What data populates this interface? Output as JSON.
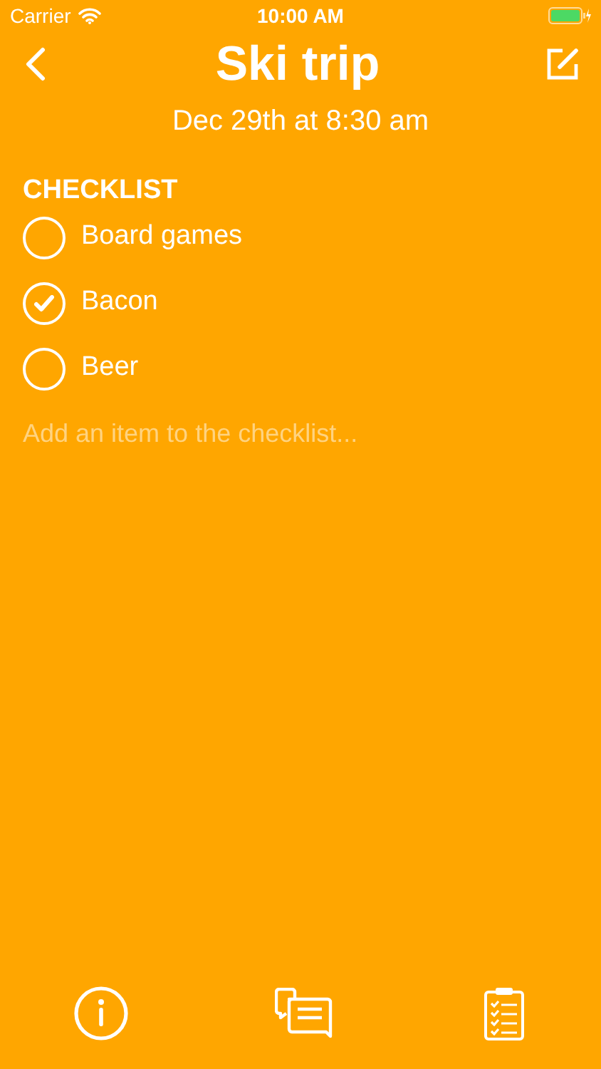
{
  "status_bar": {
    "carrier": "Carrier",
    "time": "10:00 AM"
  },
  "header": {
    "title": "Ski trip",
    "subtitle": "Dec 29th at 8:30 am"
  },
  "checklist": {
    "heading": "CHECKLIST",
    "items": [
      {
        "label": "Board games",
        "checked": false
      },
      {
        "label": "Bacon",
        "checked": true
      },
      {
        "label": "Beer",
        "checked": false
      }
    ],
    "add_field": {
      "placeholder": "Add an item to the checklist..."
    }
  }
}
